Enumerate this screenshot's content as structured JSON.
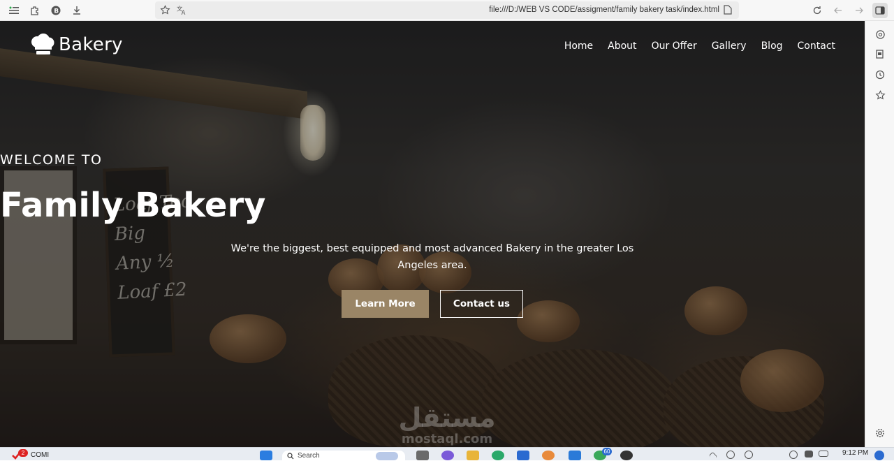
{
  "browser": {
    "url": "file:///D:/WEB VS CODE/assigment/family bakery task/index.html"
  },
  "site": {
    "brand": "Bakery",
    "nav": [
      "Home",
      "About",
      "Our Offer",
      "Gallery",
      "Blog",
      "Contact"
    ],
    "hero": {
      "eyebrow": "WELCOME TO",
      "title": "Family Bakery",
      "subtitle": "We're the biggest, best equipped and most advanced Bakery in the greater Los Angeles area.",
      "primary_button": "Learn More",
      "secondary_button": "Contact us"
    },
    "background_chalkboard": "Loaf Too\nBig\nAny ½\nLoaf £2"
  },
  "watermark": {
    "arabic": "مستقل",
    "latin": "mostaql.com"
  },
  "taskbar": {
    "left_app_label": "COMI",
    "left_app_badge": "2",
    "search_placeholder": "Search",
    "app_badge": "60",
    "time": "9:12 PM"
  },
  "colors": {
    "accent_button": "#9a8566",
    "text": "#ffffff"
  }
}
